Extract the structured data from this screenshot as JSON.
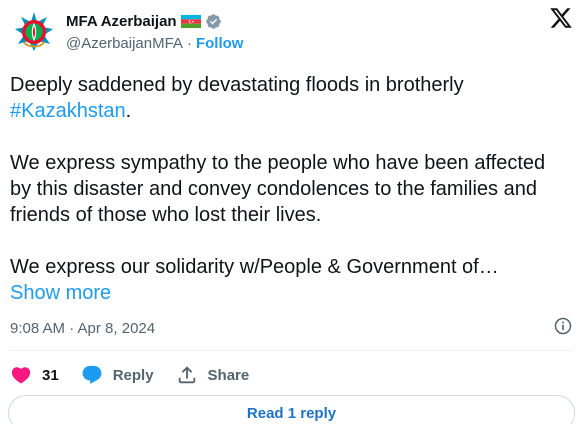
{
  "author": {
    "display_name": "MFA Azerbaijan",
    "handle": "@AzerbaijanMFA",
    "separator": "·",
    "follow_label": "Follow",
    "avatar_icon": "azerbaijan-emblem-icon",
    "flag_icon": "azerbaijan-flag-icon",
    "verified_icon": "gray-verified-badge-icon",
    "verified_color": "#829aab"
  },
  "platform_logo": "x-logo-icon",
  "tweet": {
    "line1_text": "Deeply saddened by devastating floods in brotherly",
    "hashtag": "#Kazakhstan",
    "line1_end": ".",
    "para2": "We express sympathy to the people who have been affected by this disaster and convey condolences to the families and friends of those who lost their lives.",
    "para3": "We express our solidarity w/People & Government of…",
    "show_more": "Show more"
  },
  "meta": {
    "timestamp": "9:08 AM · Apr 8, 2024",
    "info_icon": "info-icon"
  },
  "actions": {
    "like_count": "31",
    "like_icon": "heart-icon",
    "like_color": "#f91880",
    "reply_label": "Reply",
    "reply_icon": "speech-bubble-icon",
    "share_label": "Share",
    "share_icon": "share-upload-icon"
  },
  "read_replies": {
    "label": "Read 1 reply"
  },
  "colors": {
    "accent": "#1d9bf0",
    "text": "#0f1419",
    "muted": "#536471"
  }
}
